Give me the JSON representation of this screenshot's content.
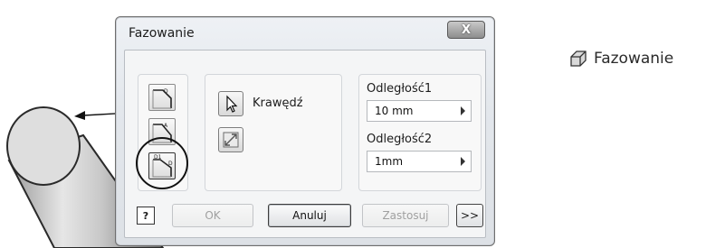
{
  "dialog": {
    "title": "Fazowanie",
    "close_glyph": "X",
    "edge_group": {
      "edge_label": "Krawędź"
    },
    "distances": {
      "distance1_label": "Odległość1",
      "distance1_value": "10 mm",
      "distance2_label": "Odległość2",
      "distance2_value": "1mm"
    },
    "buttons": {
      "help_glyph": "?",
      "ok": "OK",
      "cancel": "Anuluj",
      "apply": "Zastosuj",
      "more": ">>"
    }
  },
  "command": {
    "label": "Fazowanie",
    "icon": "chamfer-icon"
  }
}
